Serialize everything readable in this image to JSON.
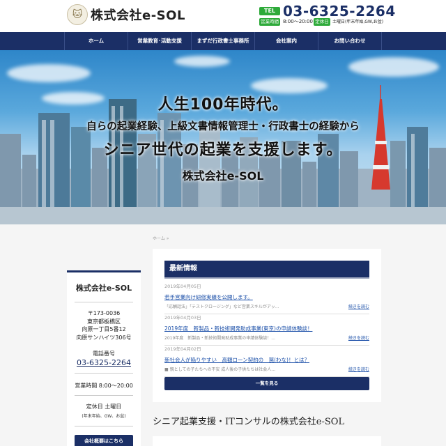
{
  "header": {
    "logo_text": "株式会社e-SOL",
    "tel_label": "TEL",
    "tel_number": "03-6325-2264",
    "hours_label": "営業時間",
    "hours_value": "8:00〜20:00",
    "holiday_label": "定休日",
    "holiday_value": "土曜日(年末年始,GW,お盆)"
  },
  "nav": {
    "items": [
      {
        "label": "ホーム"
      },
      {
        "label": "営業教育･活動支援"
      },
      {
        "label": "まずだ行政書士事務所"
      },
      {
        "label": "会社案内"
      },
      {
        "label": "お問い合わせ"
      }
    ]
  },
  "hero": {
    "line1": "人生100年時代。",
    "line2": "自らの起業経験、上級文書情報管理士・行政書士の経験から",
    "line3": "シニア世代の起業を支援します。",
    "line4": "株式会社e-SOL"
  },
  "breadcrumb": "ホーム »",
  "sidebar": {
    "title": "株式会社e-SOL",
    "postal": "〒173-0036",
    "addr1": "東京都板橋区",
    "addr2": "向原一丁目5番12",
    "addr3": "向原サンハイツ306号",
    "tel_label": "電話番号",
    "tel": "03-6325-2264",
    "hours": "営業時間 8:00〜20:00",
    "holiday": "定休日 土曜日",
    "holiday_note": "(年末年始、GW、お盆)",
    "button": "会社概要はこちら"
  },
  "news": {
    "heading": "最新情報",
    "items": [
      {
        "date": "2019年04月05日",
        "title": "若手営業向け研修実績を公開します。",
        "excerpt": "「応酬話法」「テストクロージング」など営業スキルがアッ...",
        "more": "続きを読む"
      },
      {
        "date": "2019年04月03日",
        "title": "2019年度　新製品・新技術開発助成事業(東京)の申請体験談！",
        "excerpt": "2019年度　新製品・新技術開発助成事業の申請体験談！...",
        "more": "続きを読む"
      },
      {
        "date": "2019年04月02日",
        "title": "新社会人が陥りやすい　高額ローン契約の　罠(わな)！とは？",
        "excerpt": "■ 親としての子たちへの不安 成人後の子供たちは社会人...",
        "more": "続きを読む"
      }
    ],
    "all_button": "一覧を見る"
  },
  "section": {
    "title": "シニア起業支援・ITコンサルの株式会社e-SOL"
  },
  "colors": {
    "navy": "#1b2f66",
    "green": "#2eaa3a",
    "link": "#1b4fa8"
  }
}
